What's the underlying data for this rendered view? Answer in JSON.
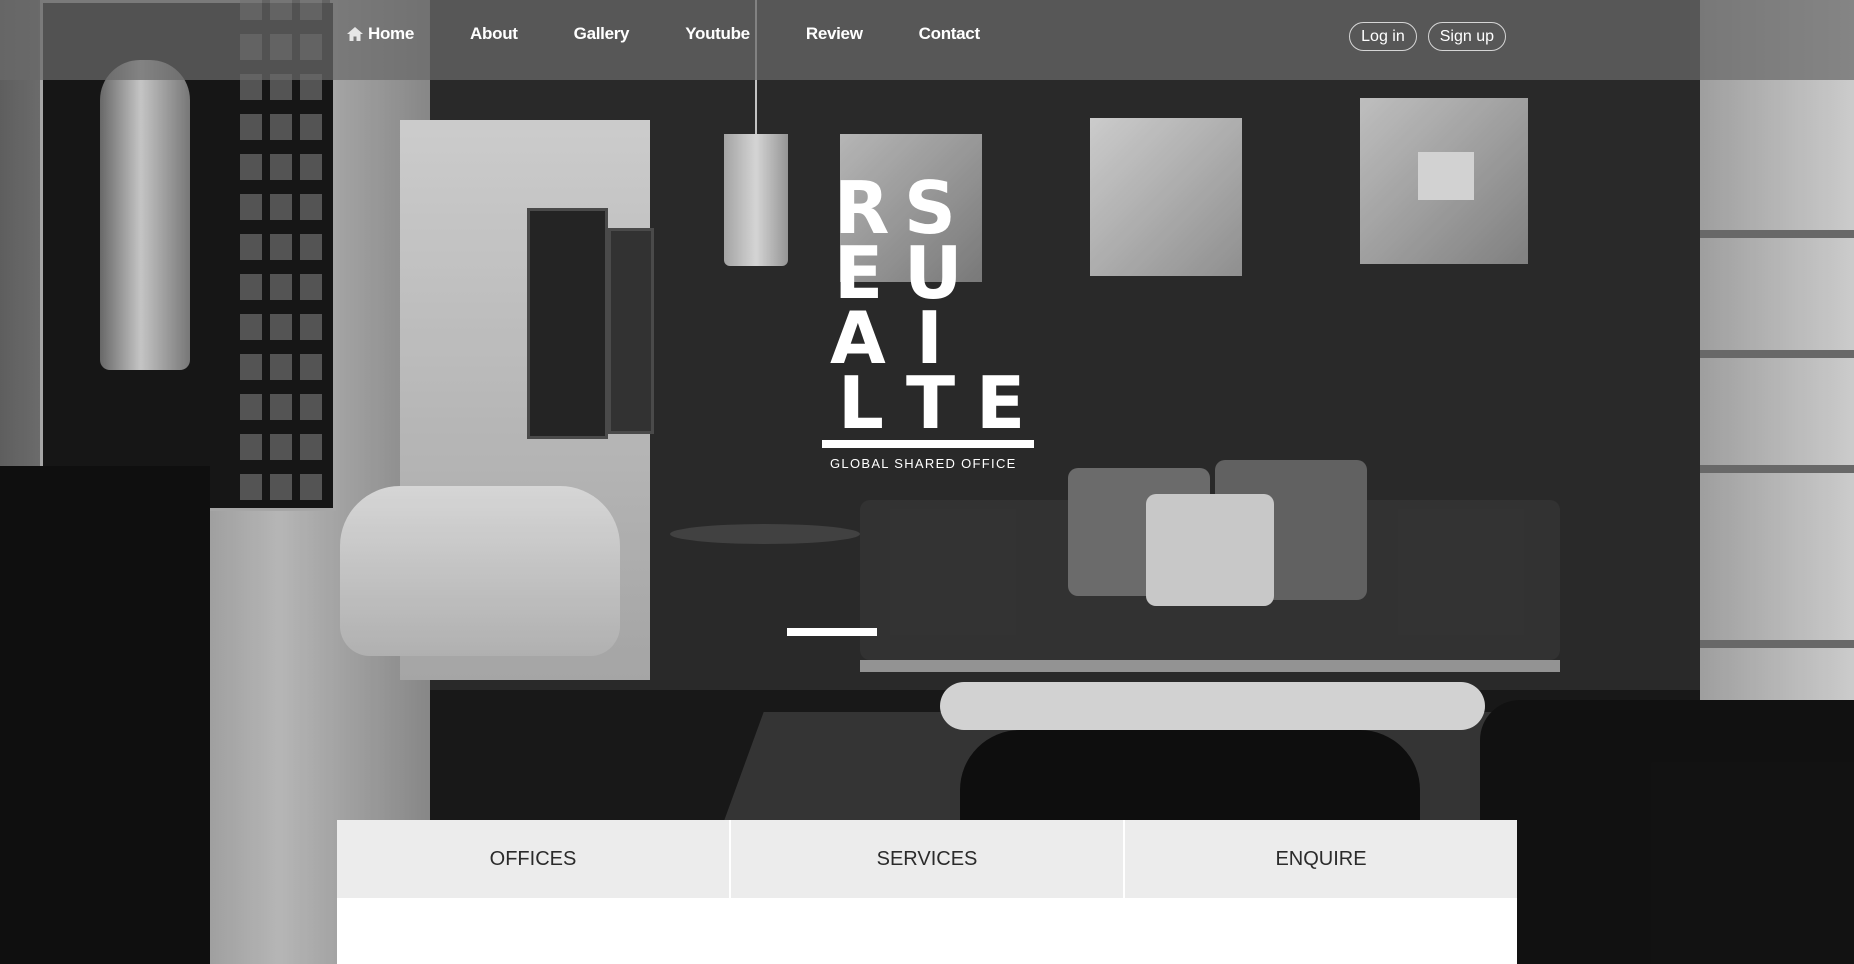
{
  "nav": {
    "items": [
      {
        "label": "Home",
        "icon": "home-icon"
      },
      {
        "label": "About"
      },
      {
        "label": "Gallery"
      },
      {
        "label": "Youtube"
      },
      {
        "label": "Review"
      },
      {
        "label": "Contact"
      }
    ]
  },
  "auth": {
    "login_label": "Log in",
    "signup_label": "Sign up"
  },
  "logo": {
    "letters": [
      "R",
      "S",
      "E",
      "U",
      "A",
      "I",
      "L",
      "T",
      "E"
    ],
    "tagline": "GLOBAL SHARED OFFICE"
  },
  "tabs": [
    {
      "label": "OFFICES"
    },
    {
      "label": "SERVICES"
    },
    {
      "label": "ENQUIRE"
    }
  ],
  "colors": {
    "nav_background": "#696969",
    "tab_background": "#ececec",
    "text_on_dark": "#ffffff",
    "tab_text": "#2b2b2b"
  }
}
